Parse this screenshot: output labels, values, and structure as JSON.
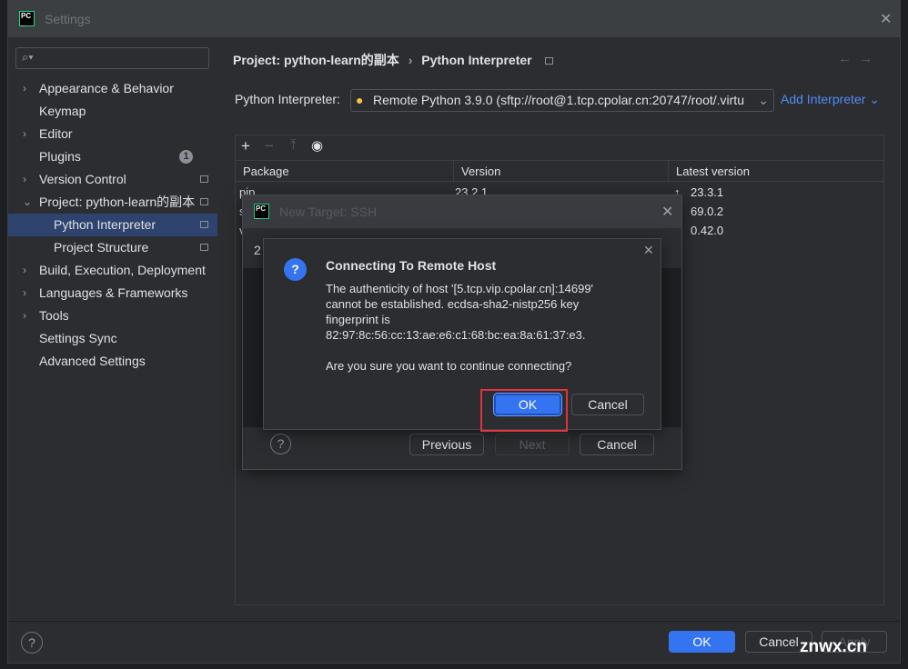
{
  "window": {
    "title": "Settings"
  },
  "sidebar": {
    "items": [
      {
        "label": "Appearance & Behavior",
        "chevron": "right"
      },
      {
        "label": "Keymap"
      },
      {
        "label": "Editor",
        "chevron": "right"
      },
      {
        "label": "Plugins",
        "badge": "1"
      },
      {
        "label": "Version Control",
        "chevron": "right",
        "pin": true
      },
      {
        "label": "Project: python-learn的副本",
        "chevron": "down",
        "pin": true
      },
      {
        "label": "Python Interpreter",
        "sub": true,
        "selected": true,
        "pin": true
      },
      {
        "label": "Project Structure",
        "sub": true,
        "pin": true
      },
      {
        "label": "Build, Execution, Deployment",
        "chevron": "right"
      },
      {
        "label": "Languages & Frameworks",
        "chevron": "right"
      },
      {
        "label": "Tools",
        "chevron": "right"
      },
      {
        "label": "Settings Sync"
      },
      {
        "label": "Advanced Settings"
      }
    ]
  },
  "breadcrumb": {
    "parent": "Project: python-learn的副本",
    "separator": "›",
    "current": "Python Interpreter"
  },
  "interpreter": {
    "label": "Python Interpreter:",
    "value": "Remote Python 3.9.0 (sftp://root@1.tcp.cpolar.cn:20747/root/.virtu",
    "add_label": "Add Interpreter"
  },
  "packages": {
    "columns": [
      "Package",
      "Version",
      "Latest version"
    ],
    "rows": [
      {
        "name": "pip",
        "version": "23.2.1",
        "latest": "23.3.1",
        "upgrade": true
      },
      {
        "name": "s",
        "version": "",
        "latest": "69.0.2",
        "upgrade": true
      },
      {
        "name": "v",
        "version": "",
        "latest": "0.42.0",
        "upgrade": true
      }
    ]
  },
  "ssh_dialog": {
    "title": "New Target: SSH",
    "step": "2",
    "previous": "Previous",
    "next": "Next",
    "cancel": "Cancel"
  },
  "confirm": {
    "title": "Connecting To Remote Host",
    "lines": [
      "The authenticity of host '[5.tcp.vip.cpolar.cn]:14699'",
      "cannot be established. ecdsa-sha2-nistp256 key",
      "fingerprint is",
      "82:97:8c:56:cc:13:ae:e6:c1:68:bc:ea:8a:61:37:e3."
    ],
    "question": "Are you sure you want to continue connecting?",
    "ok": "OK",
    "cancel": "Cancel",
    "highlight_color": "#e0333a"
  },
  "footer": {
    "ok": "OK",
    "cancel": "Cancel",
    "apply": "Apply"
  },
  "watermark": "znwx.cn",
  "accent": "#3574f0"
}
